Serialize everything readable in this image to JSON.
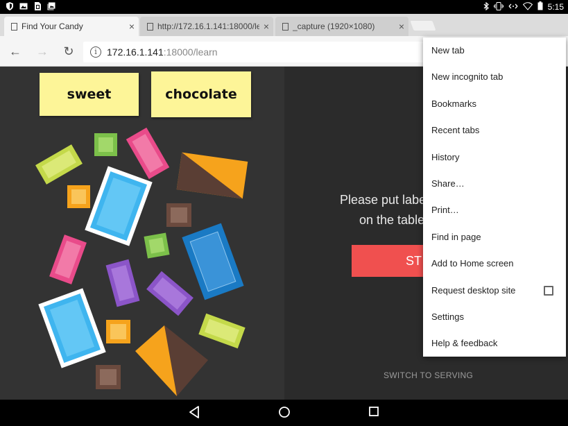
{
  "status_bar": {
    "time": "5:15"
  },
  "tabs": [
    {
      "title": "Find Your Candy",
      "close": "×",
      "active": true
    },
    {
      "title": "http://172.16.1.141:18000/le",
      "close": "×",
      "active": false
    },
    {
      "title": "_capture (1920×1080)",
      "close": "×",
      "active": false
    }
  ],
  "toolbar": {
    "back_icon": "←",
    "forward_icon": "→",
    "reload_icon": "↻",
    "info_icon": "i",
    "url_host": "172.16.1.141",
    "url_rest": ":18000/learn"
  },
  "page": {
    "labels": [
      "sweet",
      "chocolate"
    ],
    "instruction_line1": "Please put labe",
    "instruction_line2": "on the table",
    "start_button": "ST",
    "switch_link": "SWITCH TO SERVING",
    "colors": {
      "yellow_sticky": "#fdf598",
      "start_red": "#f0504f",
      "candy_green": "#7cc04a",
      "candy_pink": "#e94b8a",
      "candy_blue": "#3fb5ef",
      "candy_orange": "#f6a31c",
      "candy_brown": "#6b4a3e",
      "candy_purple": "#8b55c8",
      "candy_lime": "#c4d94a"
    }
  },
  "menu": {
    "items": [
      {
        "label": "New tab"
      },
      {
        "label": "New incognito tab"
      },
      {
        "label": "Bookmarks"
      },
      {
        "label": "Recent tabs"
      },
      {
        "label": "History"
      },
      {
        "label": "Share…"
      },
      {
        "label": "Print…"
      },
      {
        "label": "Find in page"
      },
      {
        "label": "Add to Home screen"
      },
      {
        "label": "Request desktop site",
        "checkbox": false
      },
      {
        "label": "Settings"
      },
      {
        "label": "Help & feedback"
      }
    ]
  }
}
